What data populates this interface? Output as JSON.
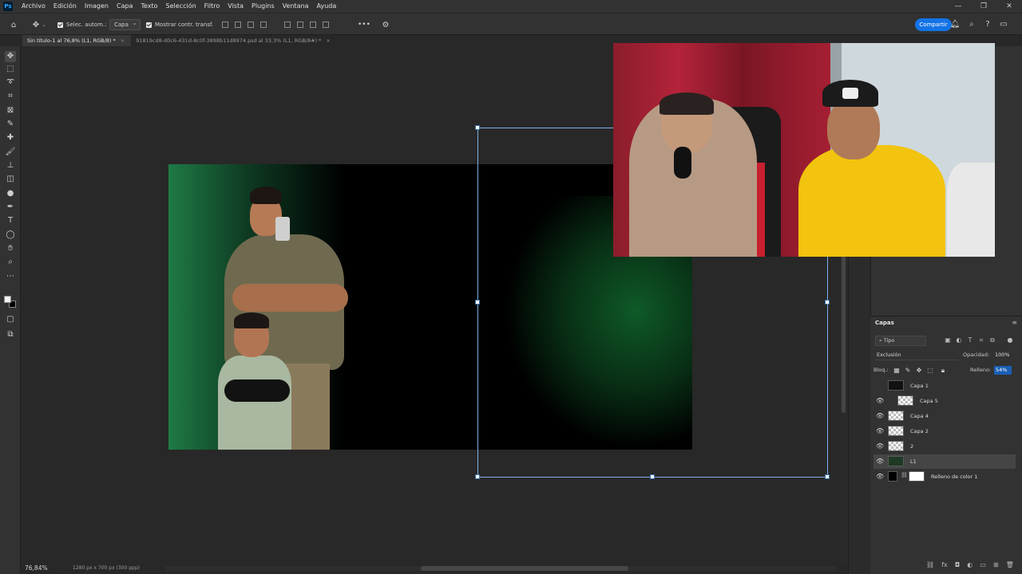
{
  "menubar": {
    "logo": "Ps",
    "items": [
      "Archivo",
      "Edición",
      "Imagen",
      "Capa",
      "Texto",
      "Selección",
      "Filtro",
      "Vista",
      "Plugins",
      "Ventana",
      "Ayuda"
    ],
    "window_controls": [
      "—",
      "❐",
      "✕"
    ]
  },
  "options": {
    "auto_select_label": "Selec. autom.:",
    "auto_select_target": "Capa",
    "show_transform_label": "Mostrar contr. transf.",
    "more_label": "•••",
    "share_button": "Compartir"
  },
  "tabs": [
    {
      "label": "Sin título-1 al 76,8% (L1, RGB/8) *",
      "close": "×"
    },
    {
      "label": "91819cd8-d0c6-431d-8c0f-3898b11d8974.psd al 33,3% (L1, RGB/8#) *",
      "close": "×"
    }
  ],
  "layers": {
    "title": "Capas",
    "filter": "Tipo",
    "blend_mode": "Exclusión",
    "opacity_label": "Opacidad:",
    "opacity_value": "100%",
    "lock_label": "Bloq.:",
    "fill_label": "Relleno:",
    "fill_value": "54%",
    "items": [
      {
        "name": "Capa 1",
        "visible": false
      },
      {
        "name": "Capa 5",
        "visible": true
      },
      {
        "name": "Capa 4",
        "visible": true
      },
      {
        "name": "Capa 2",
        "visible": true
      },
      {
        "name": "2",
        "visible": true
      },
      {
        "name": "L1",
        "visible": true,
        "active": true
      },
      {
        "name": "Relleno de color 1",
        "visible": true
      }
    ]
  },
  "status": {
    "zoom": "76,84%",
    "doc_info": "1280 px x 700 px (300 ppp)"
  },
  "colors": {
    "accent": "#1473e6",
    "fill_highlight": "#1a5fb4",
    "foreground_swatch": "#ffffff",
    "background_swatch": "#000000"
  }
}
